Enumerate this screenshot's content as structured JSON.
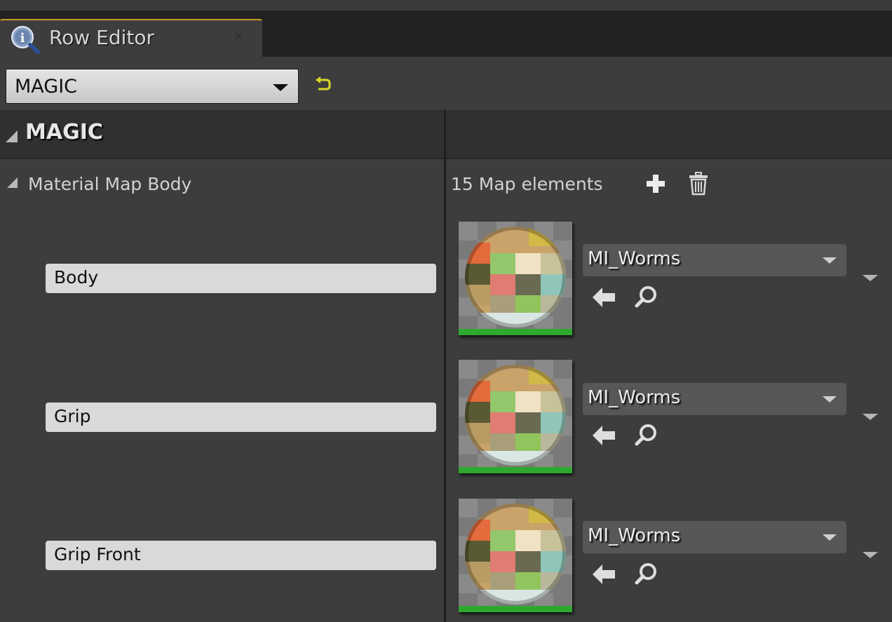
{
  "tab": {
    "title": "Row Editor",
    "icon": "info-magnifier-icon",
    "close_icon": "close-icon"
  },
  "toolbar": {
    "selected_row": "MAGIC",
    "reset_icon": "reset-to-default-icon"
  },
  "category": {
    "title": "MAGIC"
  },
  "property": {
    "name": "Material Map Body",
    "element_count": "15 Map elements",
    "add_icon": "add-icon",
    "clear_icon": "trash-icon"
  },
  "entries": [
    {
      "key": "Body",
      "material": "MI_Worms"
    },
    {
      "key": "Grip",
      "material": "MI_Worms"
    },
    {
      "key": "Grip Front",
      "material": "MI_Worms"
    }
  ],
  "colors": {
    "tab_accent": "#c79a24",
    "reset_icon": "#d8d82a",
    "thumbnail_bar": "#2ea82e"
  }
}
